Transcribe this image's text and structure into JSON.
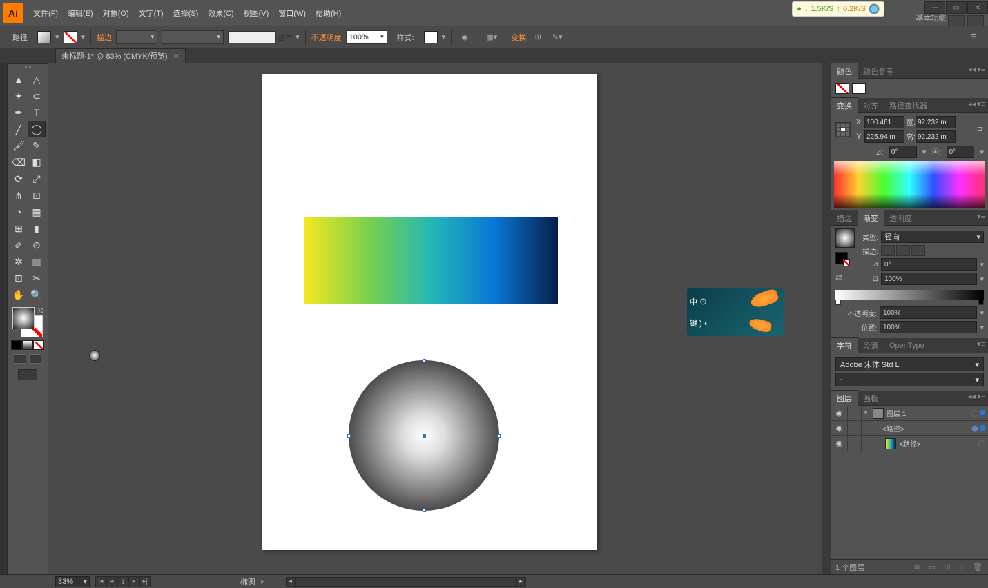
{
  "title": {
    "app_id": "Ai"
  },
  "menu": {
    "file": "文件(F)",
    "edit": "编辑(E)",
    "object": "对象(O)",
    "type": "文字(T)",
    "select": "选择(S)",
    "effect": "效果(C)",
    "view": "视图(V)",
    "window": "窗口(W)",
    "help": "帮助(H)"
  },
  "network": {
    "down": "1.5K/S",
    "up": "0.2K/S"
  },
  "workspace": "基本功能",
  "controlbar": {
    "path_label": "路径",
    "stroke_label": "描边",
    "stroke_profile": "基本",
    "opacity_label": "不透明度",
    "opacity_value": "100%",
    "style_label": "样式:",
    "transform_label": "变换"
  },
  "doctab": {
    "name": "未标题-1* @ 83% (CMYK/预览)"
  },
  "panels": {
    "color": {
      "tab_color": "颜色",
      "tab_guide": "颜色参考"
    },
    "transform": {
      "tab_transform": "变换",
      "tab_align": "对齐",
      "tab_pathfinder": "路径查找器",
      "x_label": "X:",
      "x_val": "100.461",
      "y_label": "Y:",
      "y_val": "225.94 m",
      "w_label": "宽:",
      "w_val": "92.232 m",
      "h_label": "高:",
      "h_val": "92.232 m",
      "rot_val": "0°",
      "shear_val": "0°"
    },
    "gradient": {
      "tab_stroke": "描边",
      "tab_gradient": "渐变",
      "tab_transparency": "透明度",
      "type_label": "类型:",
      "type_value": "径向",
      "stroke_label": "描边:",
      "angle_val": "0°",
      "ratio_val": "100%",
      "opacity_label": "不透明度:",
      "opacity_val": "100%",
      "loc_label": "位置:",
      "loc_val": "100%"
    },
    "char": {
      "tab_char": "字符",
      "tab_para": "段落",
      "tab_ot": "OpenType",
      "font": "Adobe 宋体 Std L",
      "weight": "-"
    },
    "layers": {
      "tab_layers": "图层",
      "tab_artboards": "画板",
      "layer1": "图层 1",
      "path1": "<路径>",
      "path2": "<路径>",
      "footer": "1 个图层"
    }
  },
  "status": {
    "zoom": "83%",
    "page": "1",
    "object": "椭圆"
  }
}
